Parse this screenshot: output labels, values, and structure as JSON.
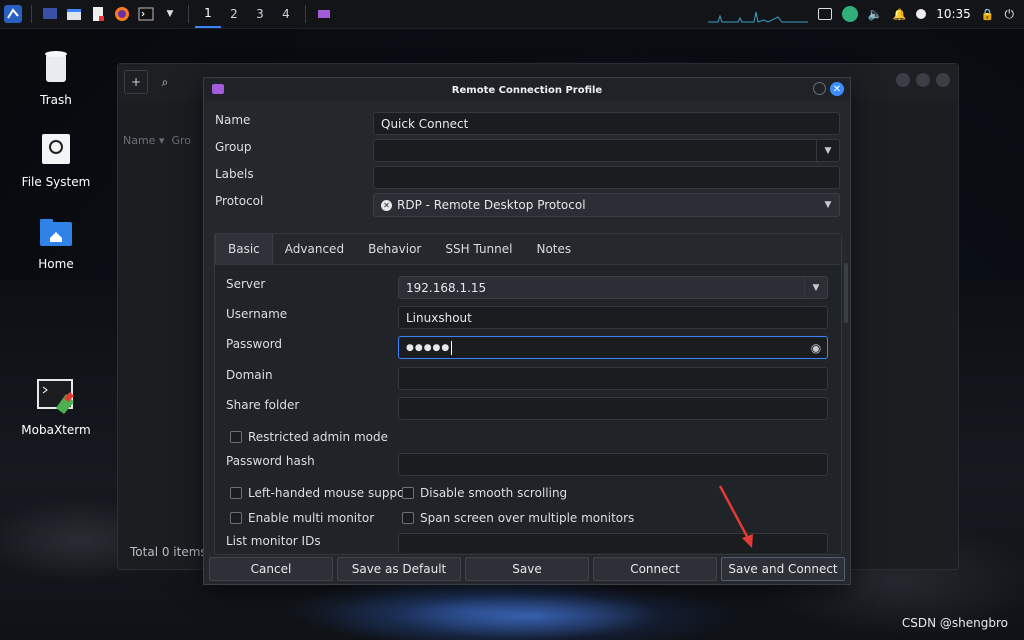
{
  "taskbar": {
    "workspaces": [
      "1",
      "2",
      "3",
      "4"
    ],
    "active_workspace": "1",
    "clock": "10:35",
    "icons": [
      "kali-menu-icon",
      "desktop-icon",
      "file-manager-icon",
      "text-editor-icon",
      "firefox-icon",
      "terminal-icon",
      "chevron-down-icon",
      "remmina-icon",
      "graph-icon",
      "network-icon",
      "volume-icon",
      "bell-icon",
      "media-icon",
      "lock-icon",
      "power-icon"
    ]
  },
  "desktop": {
    "icons": [
      {
        "label": "Trash"
      },
      {
        "label": "File System"
      },
      {
        "label": "Home"
      },
      {
        "label": "MobaXterm"
      }
    ]
  },
  "file_manager": {
    "columns": [
      "Name",
      "Gro"
    ],
    "status": "Total 0 items."
  },
  "dialog": {
    "title": "Remote Connection Profile",
    "fields": {
      "name_label": "Name",
      "name_value": "Quick Connect",
      "group_label": "Group",
      "group_value": "",
      "labels_label": "Labels",
      "labels_value": "",
      "protocol_label": "Protocol",
      "protocol_value": "RDP - Remote Desktop Protocol"
    },
    "tabs": [
      "Basic",
      "Advanced",
      "Behavior",
      "SSH Tunnel",
      "Notes"
    ],
    "active_tab": "Basic",
    "basic": {
      "server_label": "Server",
      "server_value": "192.168.1.15",
      "username_label": "Username",
      "username_value": "Linuxshout",
      "password_label": "Password",
      "password_value": "●●●●●",
      "domain_label": "Domain",
      "domain_value": "",
      "share_label": "Share folder",
      "share_value": "",
      "restricted_admin": "Restricted admin mode",
      "password_hash_label": "Password hash",
      "password_hash_value": "",
      "left_handed": "Left-handed mouse support",
      "disable_smooth": "Disable smooth scrolling",
      "multi_monitor": "Enable multi monitor",
      "span_screen": "Span screen over multiple monitors",
      "monitor_ids_label": "List monitor IDs"
    },
    "buttons": {
      "cancel": "Cancel",
      "save_default": "Save as Default",
      "save": "Save",
      "connect": "Connect",
      "save_connect": "Save and Connect"
    }
  },
  "watermark": "CSDN @shengbro",
  "colors": {
    "accent": "#3c84ff",
    "dialog_bg": "#24272c",
    "field_bg": "#1a1c20",
    "annotation_arrow": "#e53935"
  }
}
